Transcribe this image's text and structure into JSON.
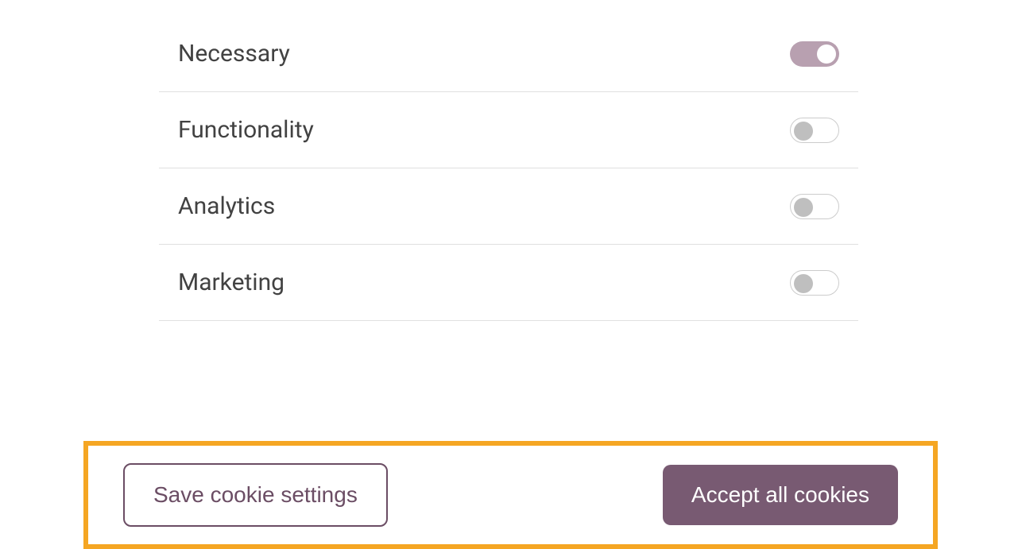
{
  "categories": [
    {
      "label": "Necessary",
      "enabled": true
    },
    {
      "label": "Functionality",
      "enabled": false
    },
    {
      "label": "Analytics",
      "enabled": false
    },
    {
      "label": "Marketing",
      "enabled": false
    }
  ],
  "buttons": {
    "save_label": "Save cookie settings",
    "accept_all_label": "Accept all cookies"
  }
}
